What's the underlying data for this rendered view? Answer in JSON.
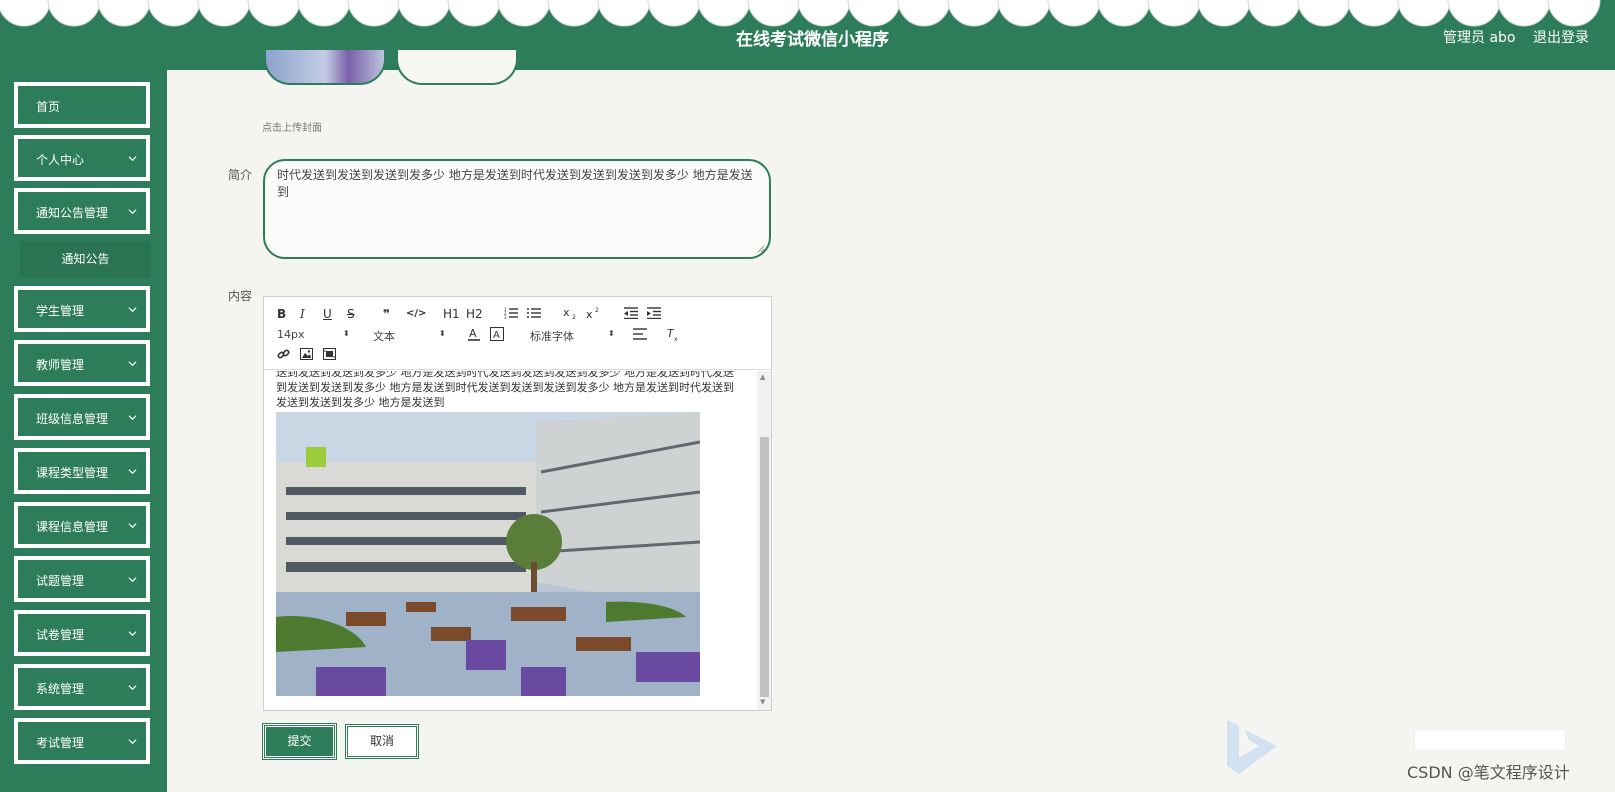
{
  "header": {
    "title": "在线考试微信小程序",
    "admin_label": "管理员 abo",
    "logout_label": "退出登录"
  },
  "sidebar": {
    "items": [
      {
        "label": "首页",
        "has_chevron": false
      },
      {
        "label": "个人中心",
        "has_chevron": true
      },
      {
        "label": "通知公告管理",
        "has_chevron": true
      },
      {
        "label": "学生管理",
        "has_chevron": true
      },
      {
        "label": "教师管理",
        "has_chevron": true
      },
      {
        "label": "班级信息管理",
        "has_chevron": true
      },
      {
        "label": "课程类型管理",
        "has_chevron": true
      },
      {
        "label": "课程信息管理",
        "has_chevron": true
      },
      {
        "label": "试题管理",
        "has_chevron": true
      },
      {
        "label": "试卷管理",
        "has_chevron": true
      },
      {
        "label": "系统管理",
        "has_chevron": true
      },
      {
        "label": "考试管理",
        "has_chevron": true
      }
    ],
    "sub_item": "通知公告"
  },
  "form": {
    "upload_hint": "点击上传封面",
    "intro_label": "简介",
    "intro_value": "时代发送到发送到发送到发多少  地方是发送到时代发送到发送到发送到发多少  地方是发送到",
    "content_label": "内容",
    "editor_text": "送到发送到发送到发多少  地方是发送到时代发送到发送到发送到发多少  地方是发送到时代发送到发送到发送到发多少  地方是发送到时代发送到发送到发送到发多少  地方是发送到时代发送到发送到发送到发多少  地方是发送到",
    "submit_label": "提交",
    "cancel_label": "取消"
  },
  "editor_toolbar": {
    "font_size": "14px",
    "block_type": "文本",
    "font_family": "标准字体",
    "buttons": [
      "B",
      "I",
      "U",
      "S",
      "❞",
      "</>",
      "H1",
      "H2"
    ]
  },
  "footer": {
    "watermark": "CSDN @笔文程序设计"
  },
  "colors": {
    "primary": "#2d7c5a",
    "background": "#f4f4f1"
  }
}
